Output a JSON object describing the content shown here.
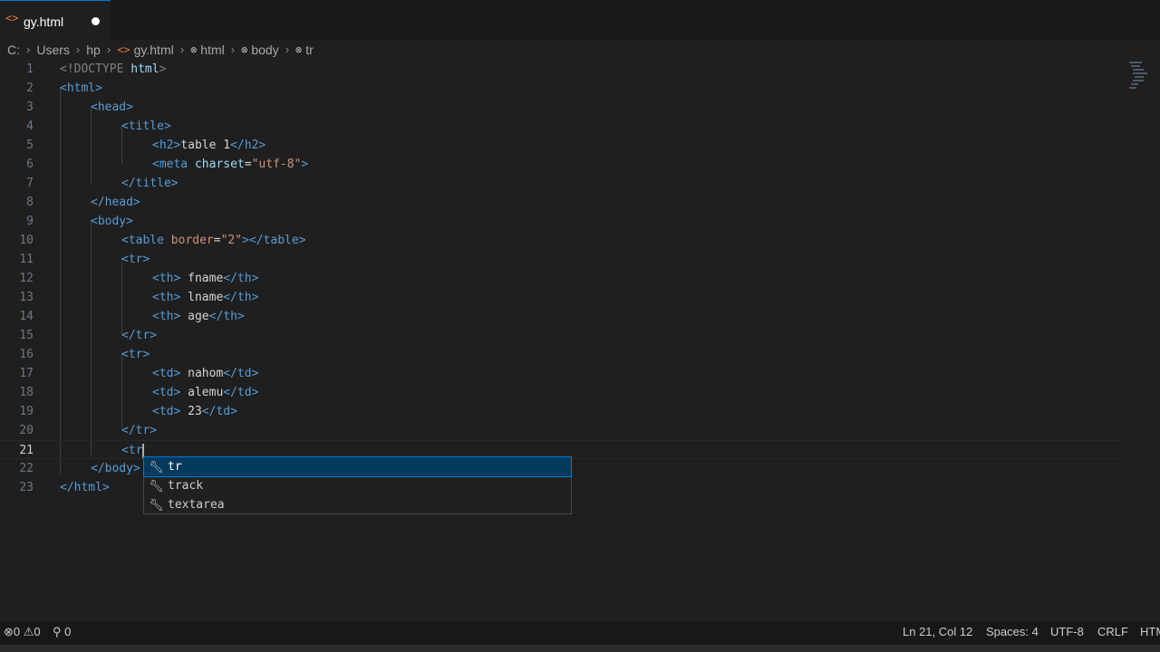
{
  "tab": {
    "icon": "html-file-icon",
    "label": "gy.html"
  },
  "breadcrumb": [
    "C:",
    "Users",
    "hp",
    "gy.html",
    "html",
    "body",
    "tr"
  ],
  "lines": [
    "1",
    "2",
    "3",
    "4",
    "5",
    "6",
    "7",
    "8",
    "9",
    "10",
    "11",
    "12",
    "13",
    "14",
    "15",
    "16",
    "17",
    "18",
    "19",
    "20",
    "21",
    "22",
    "23"
  ],
  "code": {
    "doctype": "<!DOCTYPE",
    "doctype_html": "html",
    "l2": "<html>",
    "l3": "<head>",
    "l4": "<title>",
    "l5_open": "<h2>",
    "l5_text": "table 1",
    "l5_close": "</h2>",
    "l6_open": "<meta",
    "l6_attr": "charset",
    "l6_val": "\"utf-8\"",
    "l7": "</title>",
    "l8": "</head>",
    "l9": "<body>",
    "l10_open": "<table",
    "l10_attr": "border",
    "l10_val": "\"2\"",
    "l10_close": "</table>",
    "l11": "<tr>",
    "l12_open": "<th>",
    "l12_text": " fname",
    "l12_close": "</th>",
    "l13_text": " lname",
    "l14_text": " age",
    "l15": "</tr>",
    "l16": "<tr>",
    "l17_open": "<td>",
    "l17_text": " nahom",
    "l17_close": "</td>",
    "l18_text": " alemu",
    "l19_text": " 23",
    "l20": "</tr>",
    "l21": "<tr",
    "l22": "</body>",
    "l23": "</html>"
  },
  "suggestions": [
    {
      "label": "tr",
      "icon": "wrench-icon"
    },
    {
      "label": "track",
      "icon": "wrench-icon"
    },
    {
      "label": "textarea",
      "icon": "wrench-icon"
    }
  ],
  "status": {
    "errors": "0",
    "warnings": "0",
    "ports": "0",
    "position": "Ln 21, Col 12",
    "spaces": "Spaces: 4",
    "encoding": "UTF-8",
    "eol": "CRLF",
    "language": "HTM"
  }
}
